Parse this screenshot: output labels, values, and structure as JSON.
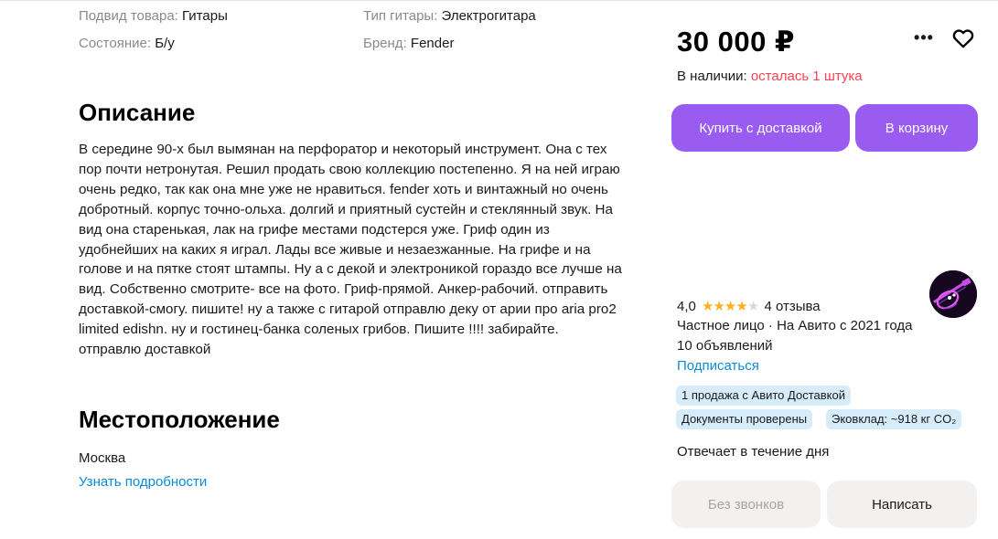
{
  "specs": {
    "subcategory_key": "Подвид товара:",
    "subcategory_value": "Гитары",
    "guitar_type_key": "Тип гитары:",
    "guitar_type_value": "Электрогитара",
    "condition_key": "Состояние:",
    "condition_value": "Б/у",
    "brand_key": "Бренд:",
    "brand_value": "Fender"
  },
  "description": {
    "heading": "Описание",
    "lines": [
      "В середине 90-х был вымянан на перфоратор и некоторый инструмент. Она с тех",
      "пор почти нетронутая. Решил продать свою коллекцию постепенно. Я на ней играю",
      "очень редко, так как она мне уже не нравиться. fender хоть и винтажный но очень",
      "добротный. корпус точно-ольха. долгий и приятный сустейн и стеклянный звук. На",
      "вид она старенькая, лак на грифе местами подстерся уже. Гриф один из",
      "удобнейших на каких я играл. Лады все живые и незаезжанные. На грифе и на",
      "голове и на пятке стоят штампы. Ну а с декой и электроникой гораздо все лучше на",
      "вид. Собственно смотрите- все на фото. Гриф-прямой. Анкер-рабочий. отправить",
      "доставкой-смогу. пишите! ну а также с гитарой отправлю деку от арии про aria pro2",
      "limited edishn. ну и гостинец-банка соленых грибов. Пишите !!!! забирайте.",
      "отправлю доставкой"
    ]
  },
  "location": {
    "heading": "Местоположение",
    "city": "Москва",
    "details_link": "Узнать подробности"
  },
  "offer": {
    "price": "30 000 ₽",
    "more_icon": "more-dots-icon",
    "favorite_icon": "heart-icon",
    "stock_label": "В наличии:",
    "stock_value": "осталась 1 штука",
    "buy_button": "Купить с доставкой",
    "cart_button": "В корзину"
  },
  "seller": {
    "rating": "4,0",
    "stars": 4,
    "reviews": "4 отзыва",
    "type_since": "Частное лицо · На Авито с 2021 года",
    "ads_count": "10 объявлений",
    "subscribe": "Подписаться",
    "badges": [
      "1 продажа с Авито Доставкой",
      "Документы проверены",
      "Эковклад: ~918 кг CO₂"
    ],
    "response_time": "Отвечает в течение дня",
    "no_calls_button": "Без звонков",
    "write_button": "Написать"
  },
  "colors": {
    "accent_purple": "#9a5cf0",
    "link_blue": "#0a8ad8",
    "stock_red": "#ff4053",
    "star_gold": "#ffb021",
    "badge_blue": "#d6ecfb"
  }
}
